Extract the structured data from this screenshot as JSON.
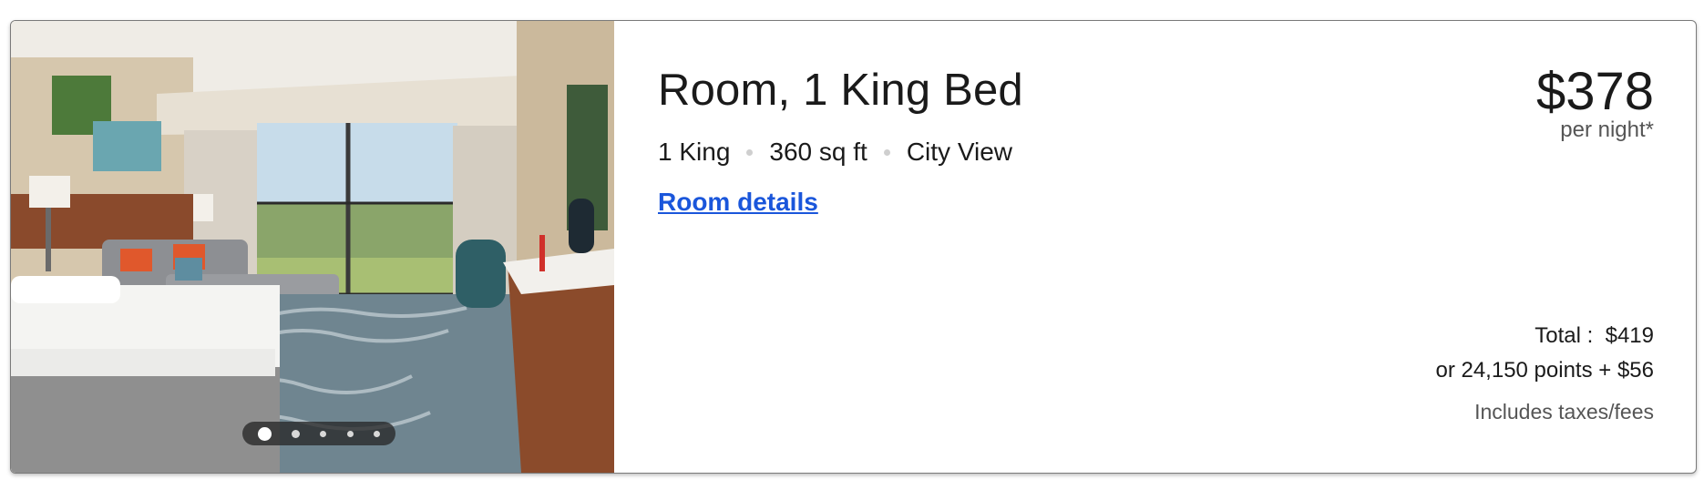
{
  "room": {
    "title": "Room, 1 King Bed",
    "features": [
      "1 King",
      "360 sq ft",
      "City View"
    ],
    "details_link": "Room details"
  },
  "price": {
    "amount": "$378",
    "unit": "per night*"
  },
  "totals": {
    "total_label": "Total :",
    "total_value": "$419",
    "points_line": "or 24,150 points + $56",
    "taxes_note": "Includes taxes/fees"
  },
  "carousel": {
    "slide_count": 5,
    "active_index": 0
  },
  "colors": {
    "link": "#1a56db",
    "text": "#1a1a1a",
    "muted": "#555555"
  }
}
